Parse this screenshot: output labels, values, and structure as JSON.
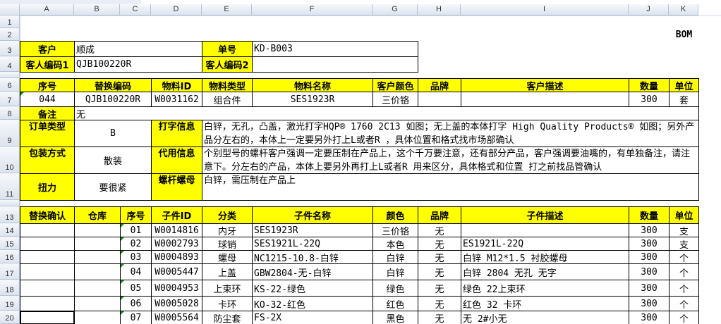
{
  "columns": [
    "A",
    "B",
    "C",
    "D",
    "E",
    "F",
    "G",
    "H",
    "I",
    "J",
    "K"
  ],
  "rows": [
    "1",
    "2",
    "3",
    "4",
    "6",
    "7",
    "8",
    "9",
    "10",
    "11",
    "13",
    "14",
    "15",
    "16",
    "17",
    "18",
    "19",
    "20"
  ],
  "top_right_label": "BOM",
  "customer_label": "客户",
  "customer_value": "顺成",
  "order_no_label": "单号",
  "order_no_value": "KD-B003",
  "cust_code1_label": "客人编码1",
  "cust_code1_value": "QJB100220R",
  "cust_code2_label": "客人编码2",
  "cust_code2_value": "",
  "main_headers": [
    "序号",
    "替换编码",
    "物料ID",
    "物料类型",
    "物料名称",
    "客户颜色",
    "品牌",
    "客户描述",
    "数量",
    "单位"
  ],
  "main_row": [
    "044",
    "QJB100220R",
    "W0031162",
    "组合件",
    "SES1923R",
    "三价铬",
    "",
    "",
    "300",
    "套"
  ],
  "remark_label": "备注",
  "remark_value": "无",
  "order_type_label": "订单类型",
  "order_type_value": "B",
  "print_info_label": "打字信息",
  "print_info_value": "白锌，无孔，凸盖，激光打字HQP® 1760 2C13 如图；无上盖的本体打字  High Quality Products® 如图；另外产品分左右的，本体上一定要另外打上L或者R ，具体位置和格式找市场部确认",
  "pack_label": "包装方式",
  "pack_value": "散装",
  "alt_info_label": "代用信息",
  "alt_info_value": "个别型号的螺杆客户强调一定要压制在产品上，这个千万要注意，还有部分产品，客户强调要油嘴的，有单独备注，请注意下。分左右的产品，本体上要另外再打上L或者R 用来区分，具体格式和位置  打之前找品管确认",
  "torque_label": "扭力",
  "torque_value": "要很紧",
  "screw_label": "螺杆螺母",
  "screw_value": "白锌，需压制在产品上",
  "child_headers": [
    "替换确认",
    "仓库",
    "序号",
    "子件ID",
    "分类",
    "子件名称",
    "颜色",
    "品牌",
    "子件描述",
    "数量",
    "单位"
  ],
  "child_rows": [
    [
      "",
      "",
      "01",
      "W0014816",
      "内牙",
      "SES1923R",
      "三价铬",
      "无",
      "",
      "300",
      "支"
    ],
    [
      "",
      "",
      "02",
      "W0002793",
      "球销",
      "SES1921L-22Q",
      "本色",
      "无",
      "ES1921L-22Q",
      "300",
      "支"
    ],
    [
      "",
      "",
      "03",
      "W0004893",
      "螺母",
      "NC1215-10.8-白锌",
      "白锌",
      "无",
      "白锌 M12*1.5 衬胶螺母",
      "300",
      "个"
    ],
    [
      "",
      "",
      "04",
      "W0005447",
      "上盖",
      "GBW2804-无-白锌",
      "白锌",
      "无",
      "白锌 2804 无孔 无字",
      "300",
      "个"
    ],
    [
      "",
      "",
      "05",
      "W0004953",
      "上束环",
      "KS-22-绿色",
      "绿色",
      "无",
      "绿色 22上束环",
      "300",
      "个"
    ],
    [
      "",
      "",
      "06",
      "W0005028",
      "卡环",
      "KO-32-红色",
      "红色",
      "无",
      "红色 32 卡环",
      "300",
      "个"
    ],
    [
      "",
      "",
      "07",
      "W0005564",
      "防尘套",
      "FS-2X",
      "黑色",
      "无",
      "无 2#小无",
      "300",
      "个"
    ]
  ]
}
